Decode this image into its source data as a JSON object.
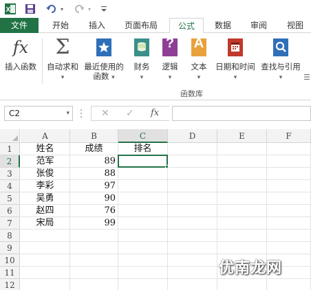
{
  "qat": {
    "icons": [
      "excel-logo-icon",
      "save-icon",
      "undo-icon",
      "redo-icon",
      "customize-icon"
    ]
  },
  "tabs": [
    {
      "label": "文件",
      "name": "tab-file"
    },
    {
      "label": "开始",
      "name": "tab-home"
    },
    {
      "label": "插入",
      "name": "tab-insert"
    },
    {
      "label": "页面布局",
      "name": "tab-page-layout"
    },
    {
      "label": "公式",
      "name": "tab-formulas"
    },
    {
      "label": "数据",
      "name": "tab-data"
    },
    {
      "label": "审阅",
      "name": "tab-review"
    },
    {
      "label": "视图",
      "name": "tab-view"
    }
  ],
  "ribbon": {
    "insert_function": "插入函数",
    "autosum": "自动求和",
    "recently_used_l1": "最近使用的",
    "recently_used_l2": "函数",
    "financial": "财务",
    "logical": "逻辑",
    "text": "文本",
    "datetime": "日期和时间",
    "lookup": "查找与引用",
    "group_label": "函数库",
    "dropdown_arrow": "▾",
    "fx_glyph": "fx",
    "sigma_glyph": "Σ",
    "logical_glyph": "?",
    "text_glyph": "A"
  },
  "formula_bar": {
    "name_box": "C2",
    "cancel": "✕",
    "enter": "✓",
    "fx": "fx",
    "formula": ""
  },
  "sheet": {
    "columns": [
      "A",
      "B",
      "C",
      "D",
      "E",
      "F"
    ],
    "rows": [
      "1",
      "2",
      "3",
      "4",
      "5",
      "6",
      "7",
      "8",
      "9",
      "10",
      "11",
      "12"
    ],
    "selected_column": "C",
    "selected_row": "2",
    "data": [
      {
        "a": "姓名",
        "b": "成绩",
        "c": "排名"
      },
      {
        "a": "范军",
        "b": "89",
        "c": ""
      },
      {
        "a": "张俊",
        "b": "88",
        "c": ""
      },
      {
        "a": "李彩",
        "b": "97",
        "c": ""
      },
      {
        "a": "吴勇",
        "b": "90",
        "c": ""
      },
      {
        "a": "赵四",
        "b": "76",
        "c": ""
      },
      {
        "a": "宋局",
        "b": "99",
        "c": ""
      }
    ]
  },
  "watermark": "优南龙网",
  "colors": {
    "accent": "#217346",
    "financial": "#3a8f8a",
    "logical": "#8e3f95",
    "text": "#e8a23c",
    "datetime": "#c0392b",
    "lookup": "#2f6fb8",
    "recent": "#2f6fb8"
  }
}
